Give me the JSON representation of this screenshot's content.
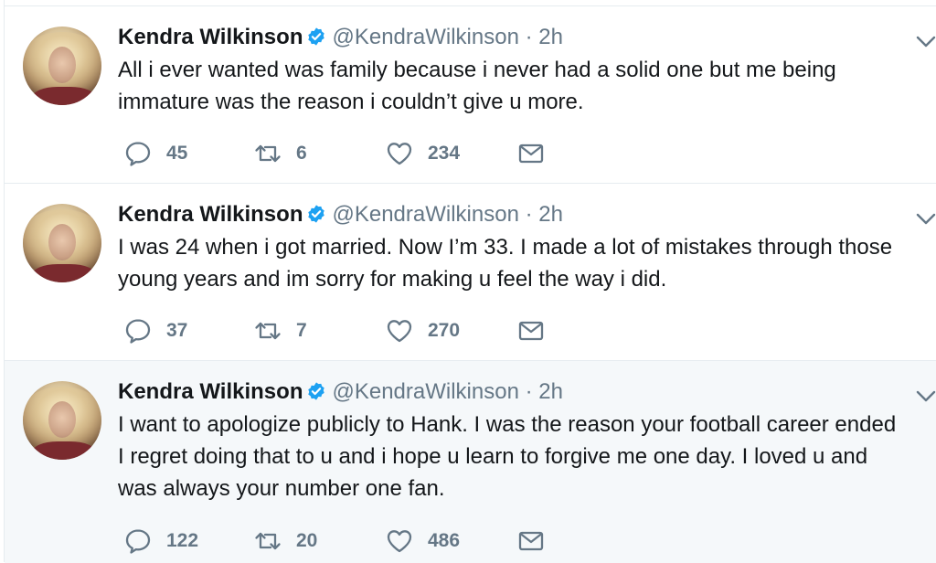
{
  "tweets": [
    {
      "name": "Kendra Wilkinson",
      "handle": "@KendraWilkinson",
      "time": "· 2h",
      "text": "All i ever wanted was family because i never had a solid one but me being\nimmature was the reason i couldn’t give u more.",
      "replies": "45",
      "retweets": "6",
      "likes": "234"
    },
    {
      "name": "Kendra Wilkinson",
      "handle": "@KendraWilkinson",
      "time": "· 2h",
      "text": "I was 24 when i got married. Now I’m 33. I made a lot of mistakes through those\nyoung years and im sorry for making u feel the way i did.",
      "replies": "37",
      "retweets": "7",
      "likes": "270"
    },
    {
      "name": "Kendra Wilkinson",
      "handle": "@KendraWilkinson",
      "time": "· 2h",
      "text": "I want to apologize publicly to Hank. I was the reason your football career ended\nI regret doing that to u and i hope u learn to forgive me one day. I loved u and\nwas always your number one fan.",
      "replies": "122",
      "retweets": "20",
      "likes": "486"
    }
  ],
  "icons": {
    "reply": "speech-bubble",
    "retweet": "retweet-arrows",
    "like": "heart-outline",
    "dm": "envelope",
    "verified": "verified-badge",
    "caret": "chevron-down"
  },
  "colors": {
    "verified_blue": "#1da1f2",
    "icon_gray": "#657786",
    "text": "#14171a",
    "hover_bg": "#f5f8fa"
  }
}
